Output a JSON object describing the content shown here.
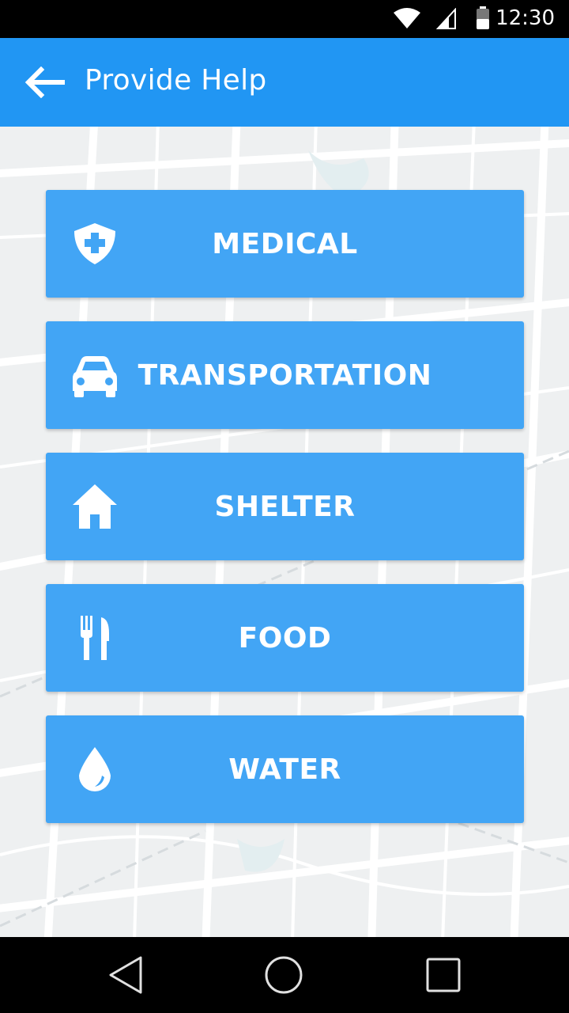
{
  "status_bar": {
    "time": "12:30"
  },
  "app_bar": {
    "title": "Provide Help",
    "back_icon": "arrow-left-icon"
  },
  "colors": {
    "app_bar": "#2196F3",
    "button": "#42A5F5",
    "map_bg": "#eef0f1"
  },
  "categories": [
    {
      "label": "MEDICAL",
      "icon": "medical-shield-icon"
    },
    {
      "label": "TRANSPORTATION",
      "icon": "car-icon"
    },
    {
      "label": "SHELTER",
      "icon": "house-icon"
    },
    {
      "label": "FOOD",
      "icon": "fork-knife-icon"
    },
    {
      "label": "WATER",
      "icon": "water-drop-icon"
    }
  ],
  "nav_bar": {
    "icons": [
      "back-triangle-icon",
      "home-circle-icon",
      "recents-square-icon"
    ]
  }
}
